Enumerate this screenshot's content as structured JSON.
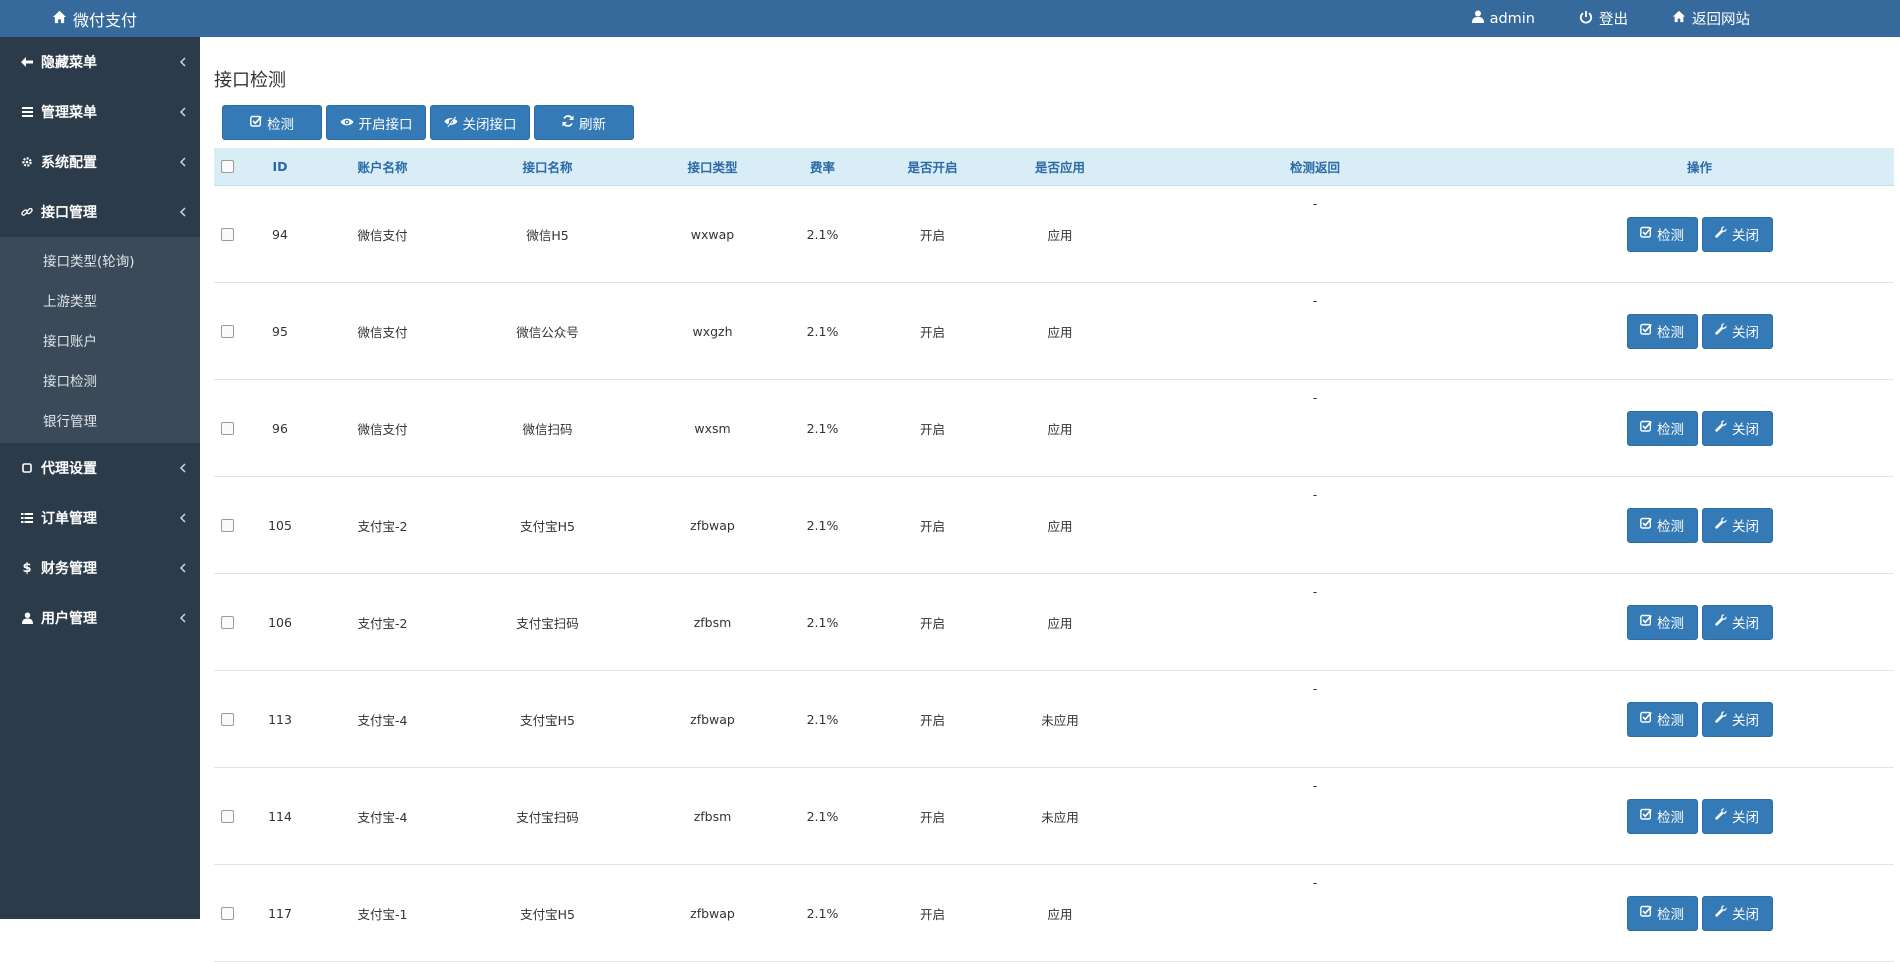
{
  "brand": {
    "name": "微付支付"
  },
  "topnav": {
    "user": "admin",
    "logout": "登出",
    "back": "返回网站"
  },
  "sidebar": {
    "items": [
      {
        "label": "隐藏菜单"
      },
      {
        "label": "管理菜单"
      },
      {
        "label": "系统配置"
      },
      {
        "label": "接口管理"
      },
      {
        "label": "代理设置"
      },
      {
        "label": "订单管理"
      },
      {
        "label": "财务管理"
      },
      {
        "label": "用户管理"
      }
    ],
    "submenu": [
      "接口类型(轮询)",
      "上游类型",
      "接口账户",
      "接口检测",
      "银行管理"
    ]
  },
  "page": {
    "title": "接口检测"
  },
  "toolbar": {
    "check": "检测",
    "open": "开启接口",
    "close": "关闭接口",
    "refresh": "刷新"
  },
  "table": {
    "headers": [
      "ID",
      "账户名称",
      "接口名称",
      "接口类型",
      "费率",
      "是否开启",
      "是否应用",
      "检测返回",
      "操作"
    ],
    "rows": [
      {
        "id": "94",
        "account": "微信支付",
        "name": "微信H5",
        "type": "wxwap",
        "rate": "2.1%",
        "open": "开启",
        "applied": "应用",
        "ret": "-"
      },
      {
        "id": "95",
        "account": "微信支付",
        "name": "微信公众号",
        "type": "wxgzh",
        "rate": "2.1%",
        "open": "开启",
        "applied": "应用",
        "ret": "-"
      },
      {
        "id": "96",
        "account": "微信支付",
        "name": "微信扫码",
        "type": "wxsm",
        "rate": "2.1%",
        "open": "开启",
        "applied": "应用",
        "ret": "-"
      },
      {
        "id": "105",
        "account": "支付宝-2",
        "name": "支付宝H5",
        "type": "zfbwap",
        "rate": "2.1%",
        "open": "开启",
        "applied": "应用",
        "ret": "-"
      },
      {
        "id": "106",
        "account": "支付宝-2",
        "name": "支付宝扫码",
        "type": "zfbsm",
        "rate": "2.1%",
        "open": "开启",
        "applied": "应用",
        "ret": "-"
      },
      {
        "id": "113",
        "account": "支付宝-4",
        "name": "支付宝H5",
        "type": "zfbwap",
        "rate": "2.1%",
        "open": "开启",
        "applied": "未应用",
        "ret": "-"
      },
      {
        "id": "114",
        "account": "支付宝-4",
        "name": "支付宝扫码",
        "type": "zfbsm",
        "rate": "2.1%",
        "open": "开启",
        "applied": "未应用",
        "ret": "-"
      },
      {
        "id": "117",
        "account": "支付宝-1",
        "name": "支付宝H5",
        "type": "zfbwap",
        "rate": "2.1%",
        "open": "开启",
        "applied": "应用",
        "ret": "-"
      }
    ],
    "row_actions": {
      "check": "检测",
      "close": "关闭"
    }
  },
  "colors": {
    "topbar": "#366a9c",
    "sidebar": "#2c3b4a",
    "submenu": "#3b4a58",
    "primary": "#337ab7",
    "thead": "#d9edf7"
  }
}
